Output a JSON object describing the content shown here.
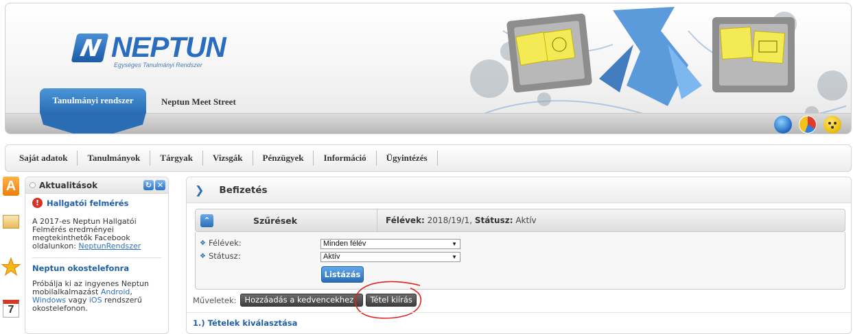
{
  "header": {
    "logo_text": "NEPTUN",
    "logo_tagline": "Egységes Tanulmányi Rendszer",
    "tab_active": "Tanulmányi rendszer",
    "tab_other": "Neptun Meet Street",
    "brand_color": "#2a6db5",
    "icons": [
      "globe-icon",
      "contrast-icon",
      "accessibility-icon"
    ]
  },
  "menu": {
    "items": [
      "Saját adatok",
      "Tanulmányok",
      "Tárgyak",
      "Vizsgák",
      "Pénzügyek",
      "Információ",
      "Ügyintézés"
    ]
  },
  "side_icons": {
    "calendar_day": "7",
    "a_letter": "A"
  },
  "news": {
    "title": "Aktualitások",
    "items": [
      {
        "title": "Hallgatói felmérés",
        "text": "A 2017-es Neptun Hallgatói Felmérés eredményei megtekinthetők Facebook oldalunkon: ",
        "link": "NeptunRendszer"
      },
      {
        "title": "Neptun okostelefonra",
        "text_1": "Próbálja ki az ingyenes Neptun mobilalkalmazást ",
        "link_1": "Android",
        "text_2": ", ",
        "link_2": "Windows",
        "text_3": " vagy ",
        "link_3": "iOS",
        "text_4": " rendszerű okostelefonon."
      }
    ]
  },
  "content": {
    "title": "Befizetés",
    "filter": {
      "label": "Szűrések",
      "summary_k1": "Félévek:",
      "summary_v1": " 2018/19/1, ",
      "summary_k2": "Státusz:",
      "summary_v2": " Aktív",
      "rows": [
        {
          "label": "Félévek:",
          "value": "Minden félév"
        },
        {
          "label": "Státusz:",
          "value": "Aktív"
        }
      ],
      "button": "Listázás"
    },
    "operations": {
      "label": "Műveletek:",
      "buttons": [
        "Hozzáadás a kedvencekhez",
        "Tétel kiírás"
      ]
    },
    "section_title": "1.) Tételek kiválasztása",
    "annotation_color": "#e0201b"
  }
}
